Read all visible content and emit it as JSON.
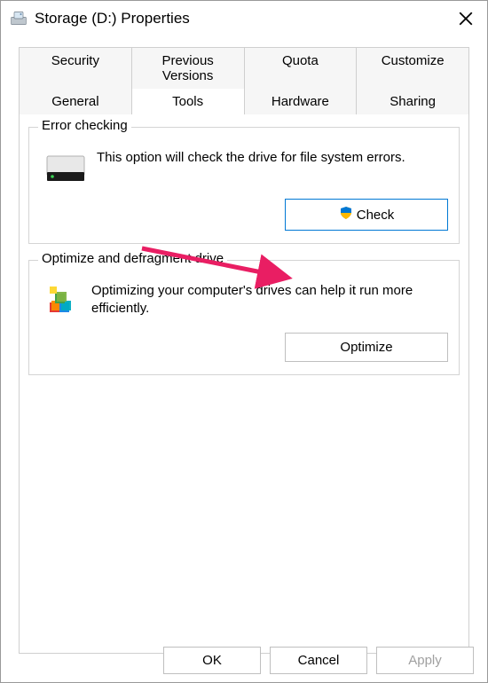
{
  "titlebar": {
    "title": "Storage (D:) Properties",
    "icon_name": "drive-icon",
    "close_name": "close-icon"
  },
  "tabs": {
    "row1": [
      {
        "label": "Security"
      },
      {
        "label": "Previous Versions"
      },
      {
        "label": "Quota"
      },
      {
        "label": "Customize"
      }
    ],
    "row2": [
      {
        "label": "General"
      },
      {
        "label": "Tools",
        "active": true
      },
      {
        "label": "Hardware"
      },
      {
        "label": "Sharing"
      }
    ]
  },
  "error_checking": {
    "legend": "Error checking",
    "description": "This option will check the drive for file system errors.",
    "button_label": "Check",
    "shield_icon": "shield-icon"
  },
  "optimize": {
    "legend": "Optimize and defragment drive",
    "description": "Optimizing your computer's drives can help it run more efficiently.",
    "button_label": "Optimize"
  },
  "bottom": {
    "ok": "OK",
    "cancel": "Cancel",
    "apply": "Apply"
  },
  "annotation": {
    "arrow_color": "#e91e63"
  }
}
